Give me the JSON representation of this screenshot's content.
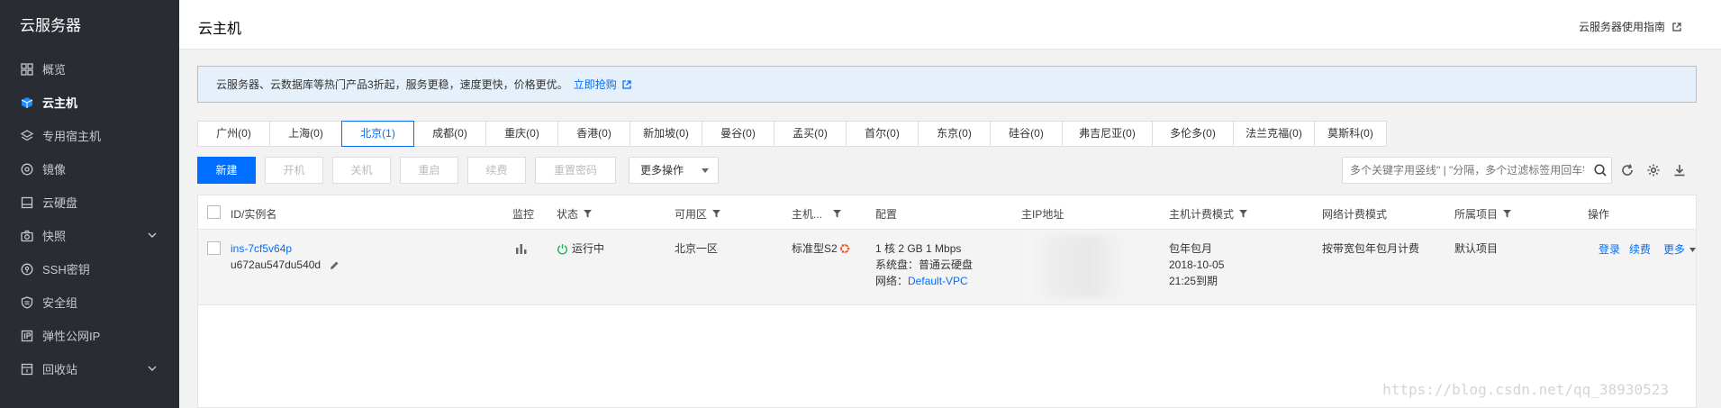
{
  "sidebar": {
    "brand": "云服务器",
    "items": [
      {
        "label": "概览",
        "icon": "grid-icon"
      },
      {
        "label": "云主机",
        "icon": "cube-icon",
        "active": true
      },
      {
        "label": "专用宿主机",
        "icon": "layers-icon"
      },
      {
        "label": "镜像",
        "icon": "disc-icon"
      },
      {
        "label": "云硬盘",
        "icon": "harddisk-icon"
      },
      {
        "label": "快照",
        "icon": "camera-icon",
        "expandable": true
      },
      {
        "label": "SSH密钥",
        "icon": "key-icon"
      },
      {
        "label": "安全组",
        "icon": "shield-icon"
      },
      {
        "label": "弹性公网IP",
        "icon": "ip-icon"
      },
      {
        "label": "回收站",
        "icon": "trash-icon",
        "expandable": true
      }
    ]
  },
  "header": {
    "title": "云主机",
    "guide_link": "云服务器使用指南"
  },
  "notice": {
    "text": "云服务器、云数据库等热门产品3折起，服务更稳，速度更快，价格更优。",
    "link": "立即抢购"
  },
  "regions": [
    {
      "label": "广州(0)"
    },
    {
      "label": "上海(0)"
    },
    {
      "label": "北京(1)",
      "active": true
    },
    {
      "label": "成都(0)"
    },
    {
      "label": "重庆(0)"
    },
    {
      "label": "香港(0)"
    },
    {
      "label": "新加坡(0)"
    },
    {
      "label": "曼谷(0)"
    },
    {
      "label": "孟买(0)"
    },
    {
      "label": "首尔(0)"
    },
    {
      "label": "东京(0)"
    },
    {
      "label": "硅谷(0)"
    },
    {
      "label": "弗吉尼亚(0)"
    },
    {
      "label": "多伦多(0)"
    },
    {
      "label": "法兰克福(0)"
    },
    {
      "label": "莫斯科(0)"
    }
  ],
  "toolbar": {
    "new": "新建",
    "start": "开机",
    "shutdown": "关机",
    "restart": "重启",
    "renew": "续费",
    "reset_password": "重置密码",
    "more_actions": "更多操作",
    "search_placeholder": "多个关键字用竖线\" | \"分隔，多个过滤标签用回车键分隔"
  },
  "table": {
    "columns": {
      "id": "ID/实例名",
      "monitor": "监控",
      "status": "状态",
      "zone": "可用区",
      "host": "主机...",
      "config": "配置",
      "ip": "主IP地址",
      "billing": "主机计费模式",
      "network_billing": "网络计费模式",
      "project": "所属项目",
      "actions": "操作"
    },
    "rows": [
      {
        "id": "ins-7cf5v64p",
        "name": "u672au547du540d",
        "status": "运行中",
        "zone": "北京一区",
        "host_type": "标准型S2",
        "config_line1": "1 核 2 GB 1 Mbps",
        "config_line2": "系统盘：普通云硬盘",
        "config_line3_label": "网络：",
        "config_line3_link": "Default-VPC",
        "billing_line1": "包年包月",
        "billing_line2": "2018-10-05",
        "billing_line3": "21:25到期",
        "network_billing": "按带宽包年包月计费",
        "project": "默认项目",
        "action_login": "登录",
        "action_renew": "续费",
        "action_more": "更多"
      }
    ]
  },
  "watermark": "https://blog.csdn.net/qq_38930523",
  "colors": {
    "accent": "#006eff",
    "sidebar_bg": "#292d33",
    "running_status": "#0abf5b"
  }
}
